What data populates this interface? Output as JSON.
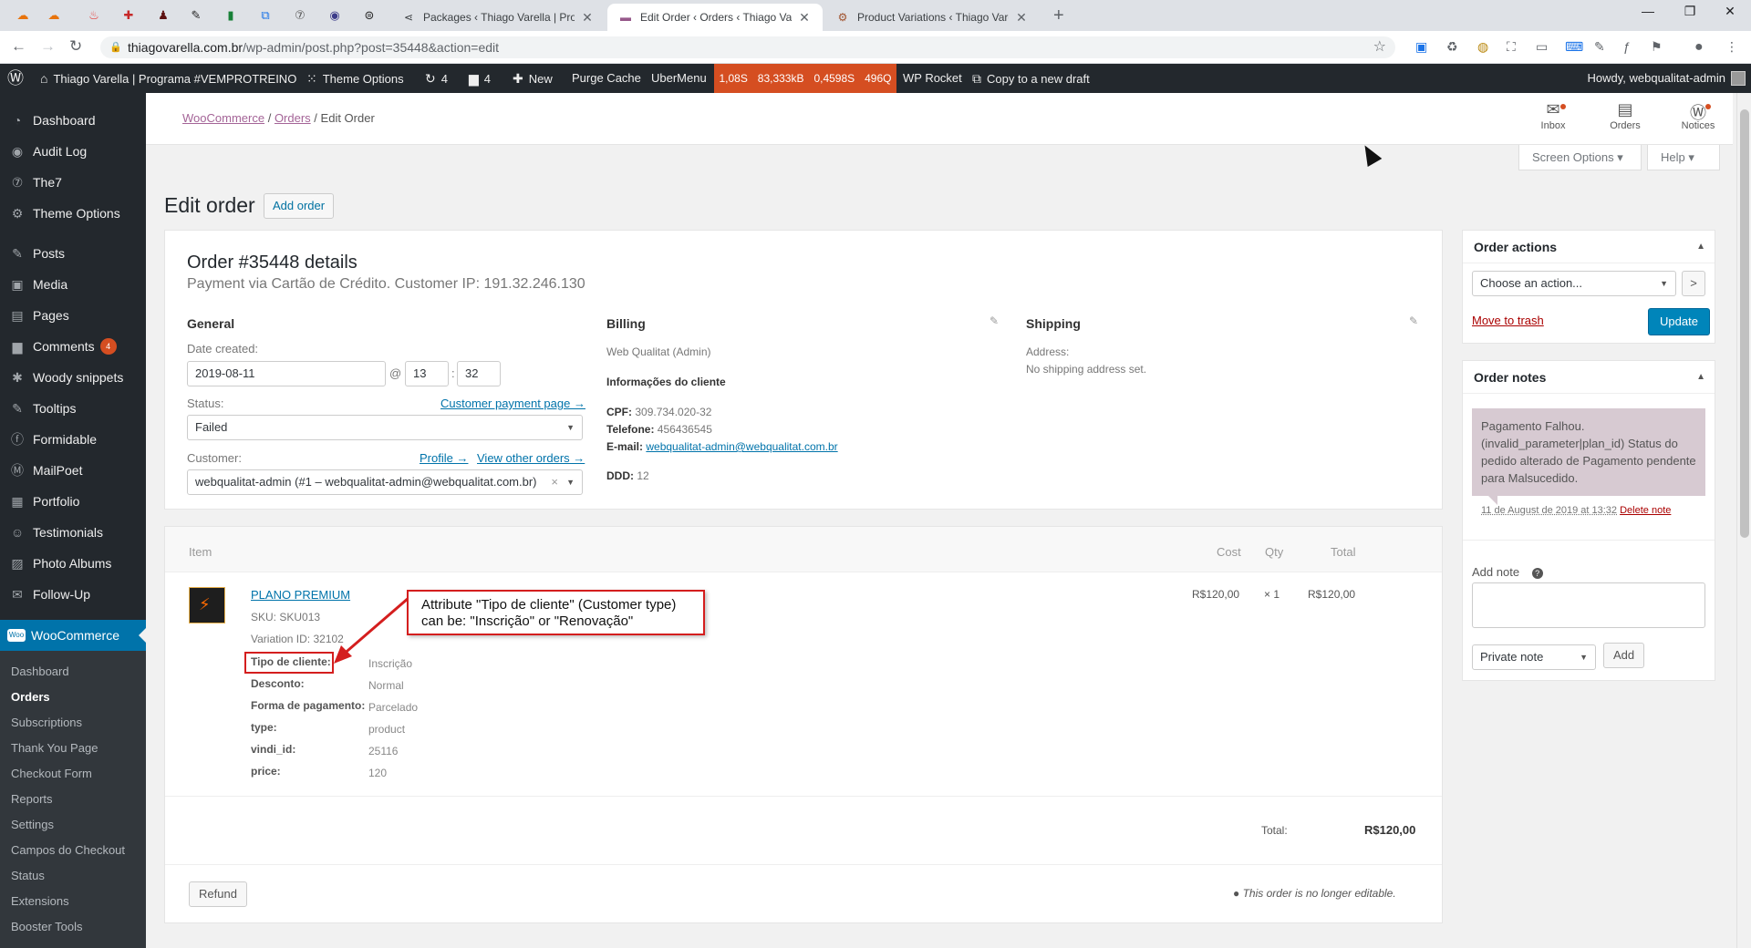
{
  "browser": {
    "tabs": [
      {
        "title": "Packages ‹ Thiago Varella | Progr",
        "active": false
      },
      {
        "title": "Edit Order ‹ Orders ‹ Thiago Vare",
        "active": true
      },
      {
        "title": "Product Variations ‹ Thiago Varel",
        "active": false
      }
    ],
    "new_tab": "+",
    "close": "✕",
    "url_host": "thiagovarella.com.br",
    "url_path": "/wp-admin/post.php?post=35448&action=edit"
  },
  "admin_bar": {
    "site_name": "Thiago Varella | Programa #VEMPROTREINO",
    "theme_options": "Theme Options",
    "updates_count": "4",
    "comments_count": "4",
    "new": "New",
    "purge_cache": "Purge Cache",
    "ubermenu": "UberMenu",
    "perf": [
      "1,08S",
      "83,333kB",
      "0,4598S",
      "496Q"
    ],
    "wp_rocket": "WP Rocket",
    "copy_draft": "Copy to a new draft",
    "howdy": "Howdy, webqualitat-admin"
  },
  "sidebar": {
    "items": [
      {
        "label": "Dashboard",
        "icon": "◔"
      },
      {
        "label": "Audit Log",
        "icon": "◉"
      },
      {
        "label": "The7",
        "icon": "⑦"
      },
      {
        "label": "Theme Options",
        "icon": "⚙"
      },
      {
        "label": "Posts",
        "icon": "✎"
      },
      {
        "label": "Media",
        "icon": "▣"
      },
      {
        "label": "Pages",
        "icon": "▤"
      },
      {
        "label": "Comments",
        "icon": "▆",
        "badge": "4"
      },
      {
        "label": "Woody snippets",
        "icon": "✱"
      },
      {
        "label": "Tooltips",
        "icon": "✎"
      },
      {
        "label": "Formidable",
        "icon": "ⓕ"
      },
      {
        "label": "MailPoet",
        "icon": "Ⓜ"
      },
      {
        "label": "Portfolio",
        "icon": "▦"
      },
      {
        "label": "Testimonials",
        "icon": "☺"
      },
      {
        "label": "Photo Albums",
        "icon": "▨"
      },
      {
        "label": "Follow-Up",
        "icon": "✉"
      }
    ],
    "woocommerce": "WooCommerce",
    "woo_icon": "Woo",
    "submenu": [
      "Dashboard",
      "Orders",
      "Subscriptions",
      "Thank You Page",
      "Checkout Form",
      "Reports",
      "Settings",
      "Campos do Checkout",
      "Status",
      "Extensions",
      "Booster Tools"
    ]
  },
  "header": {
    "breadcrumb_root": "WooCommerce",
    "breadcrumb_orders": "Orders",
    "breadcrumb_sep": "/",
    "breadcrumb_current": "Edit Order",
    "icons": [
      {
        "label": "Inbox"
      },
      {
        "label": "Orders"
      },
      {
        "label": "Notices"
      }
    ],
    "screen_options": "Screen Options ▾",
    "help": "Help ▾"
  },
  "page": {
    "title": "Edit order",
    "add_order": "Add order"
  },
  "order": {
    "title": "Order #35448 details",
    "subtitle": "Payment via Cartão de Crédito. Customer IP: 191.32.246.130",
    "general_heading": "General",
    "date_label": "Date created:",
    "date_value": "2019-08-11",
    "at": "@",
    "hour": "13",
    "colon": ":",
    "minute": "32",
    "status_label": "Status:",
    "customer_payment_link": "Customer payment page →",
    "status_value": "Failed",
    "customer_label": "Customer:",
    "profile_link": "Profile →",
    "view_orders_link": "View other orders →",
    "customer_value": "webqualitat-admin (#1 – webqualitat-admin@webqualitat.com.br)",
    "billing_heading": "Billing",
    "billing_name": "Web Qualitat (Admin)",
    "info_heading": "Informações do cliente",
    "cpf_label": "CPF:",
    "cpf_value": "309.734.020-32",
    "phone_label": "Telefone:",
    "phone_value": "456436545",
    "email_label": "E-mail:",
    "email_value": "webqualitat-admin@webqualitat.com.br",
    "ddd_label": "DDD:",
    "ddd_value": "12",
    "shipping_heading": "Shipping",
    "address_label": "Address:",
    "address_value": "No shipping address set."
  },
  "items": {
    "headers": {
      "item": "Item",
      "cost": "Cost",
      "qty": "Qty",
      "total": "Total"
    },
    "product_name": "PLANO PREMIUM",
    "sku": "SKU:  SKU013",
    "variation_id": "Variation ID:  32102",
    "meta": [
      {
        "key": "Tipo de cliente:",
        "value": "Inscrição"
      },
      {
        "key": "Desconto:",
        "value": "Normal"
      },
      {
        "key": "Forma de pagamento:",
        "value": "Parcelado"
      },
      {
        "key": "type:",
        "value": "product"
      },
      {
        "key": "vindi_id:",
        "value": "25116"
      },
      {
        "key": "price:",
        "value": "120"
      }
    ],
    "cost": "R$120,00",
    "qty": "× 1",
    "total": "R$120,00",
    "total_label": "Total:",
    "total_value": "R$120,00",
    "refund": "Refund",
    "not_editable": "This order is no longer editable."
  },
  "annotation": {
    "line1": "Attribute \"Tipo de cliente\" (Customer type)",
    "line2": "can be: \"Inscrição\" or \"Renovação\""
  },
  "order_actions": {
    "heading": "Order actions",
    "select": "Choose an action...",
    "go": ">",
    "trash": "Move to trash",
    "update": "Update"
  },
  "order_notes": {
    "heading": "Order notes",
    "note_text": "Pagamento Falhou. (invalid_parameter|plan_id) Status do pedido alterado de Pagamento pendente para Malsucedido.",
    "note_date": "11 de August de 2019 at 13:32",
    "delete": "Delete note",
    "add_note_label": "Add note",
    "help": "?",
    "note_type": "Private note",
    "add": "Add"
  }
}
